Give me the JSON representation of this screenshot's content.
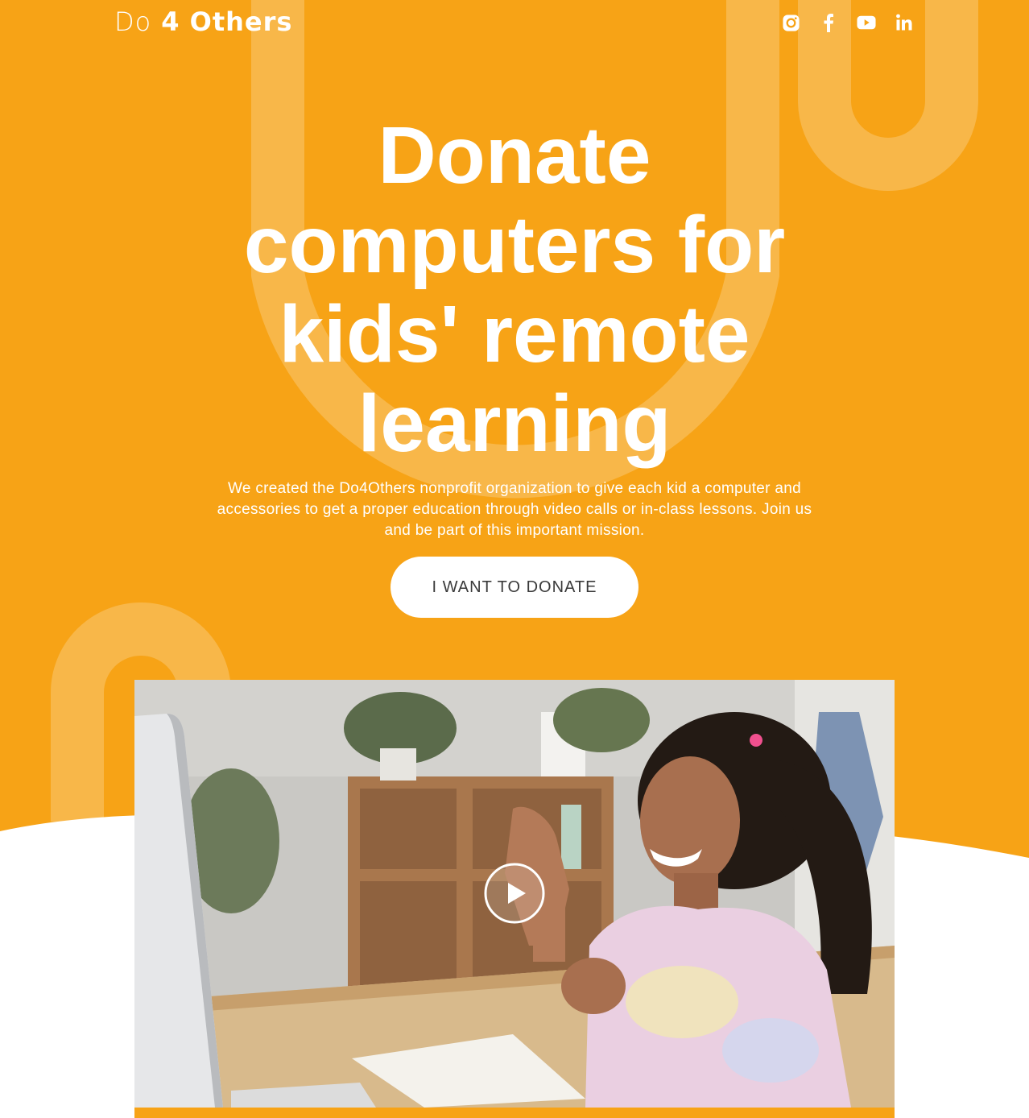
{
  "brand": {
    "logo_light": "Do",
    "logo_bold": "4 Others",
    "accent_color": "#f7a316"
  },
  "header": {
    "socials": [
      {
        "icon": "instagram-icon",
        "label": "Instagram"
      },
      {
        "icon": "facebook-icon",
        "label": "Facebook"
      },
      {
        "icon": "youtube-icon",
        "label": "YouTube"
      },
      {
        "icon": "linkedin-icon",
        "label": "LinkedIn"
      }
    ]
  },
  "hero": {
    "title_lines": [
      "Donate",
      "computers for",
      "kids' remote",
      "learning"
    ],
    "subtitle": "We created the Do4Others nonprofit organization to give each kid a computer and accessories to get a proper education through video calls or in-class lessons. Join us and be part of this important mission.",
    "cta_label": "I WANT TO DONATE"
  },
  "video": {
    "play_icon": "play-icon"
  }
}
